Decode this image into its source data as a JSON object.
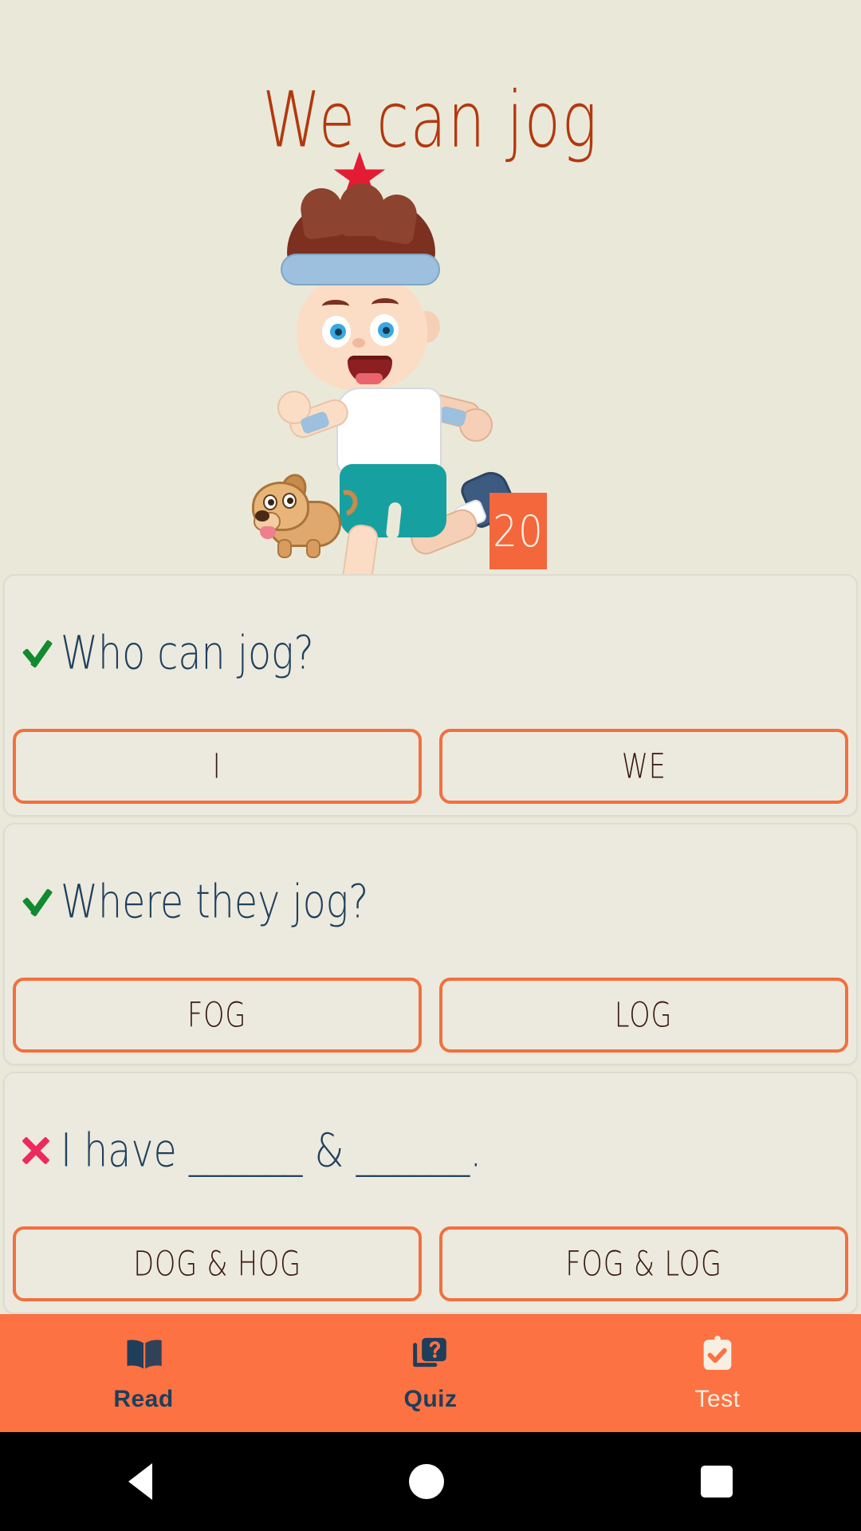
{
  "app": {
    "title": "We can jog",
    "score_badge": "20",
    "accent_orange": "#fc7243",
    "button_border": "#f1703f",
    "title_color": "#b3380e",
    "question_color": "#21415e",
    "background": "#eae9d9",
    "check_color": "#128a2f",
    "cross_color": "#ec2a5e",
    "badge_color": "#f4663c"
  },
  "illustration": {
    "star_icon": "star-icon",
    "character": "boy-jogging-with-dog-illustration"
  },
  "questions": [
    {
      "mark": "check",
      "mark_icon": "check-icon",
      "text": "Who can jog?",
      "answers": [
        "I",
        "WE"
      ]
    },
    {
      "mark": "check",
      "mark_icon": "check-icon",
      "text": "Where they jog?",
      "answers": [
        "FOG",
        "LOG"
      ]
    },
    {
      "mark": "cross",
      "mark_icon": "cross-icon",
      "text": "I have ______ & ______.",
      "answers": [
        "DOG & HOG",
        "FOG & LOG"
      ]
    }
  ],
  "bottom_nav": [
    {
      "label": "Read",
      "icon": "open-book-icon",
      "active": false
    },
    {
      "label": "Quiz",
      "icon": "question-card-icon",
      "active": false
    },
    {
      "label": "Test",
      "icon": "clipboard-check-icon",
      "active": true
    }
  ],
  "system_bar": {
    "back": "back-triangle-icon",
    "home": "home-circle-icon",
    "recents": "recents-square-icon"
  }
}
